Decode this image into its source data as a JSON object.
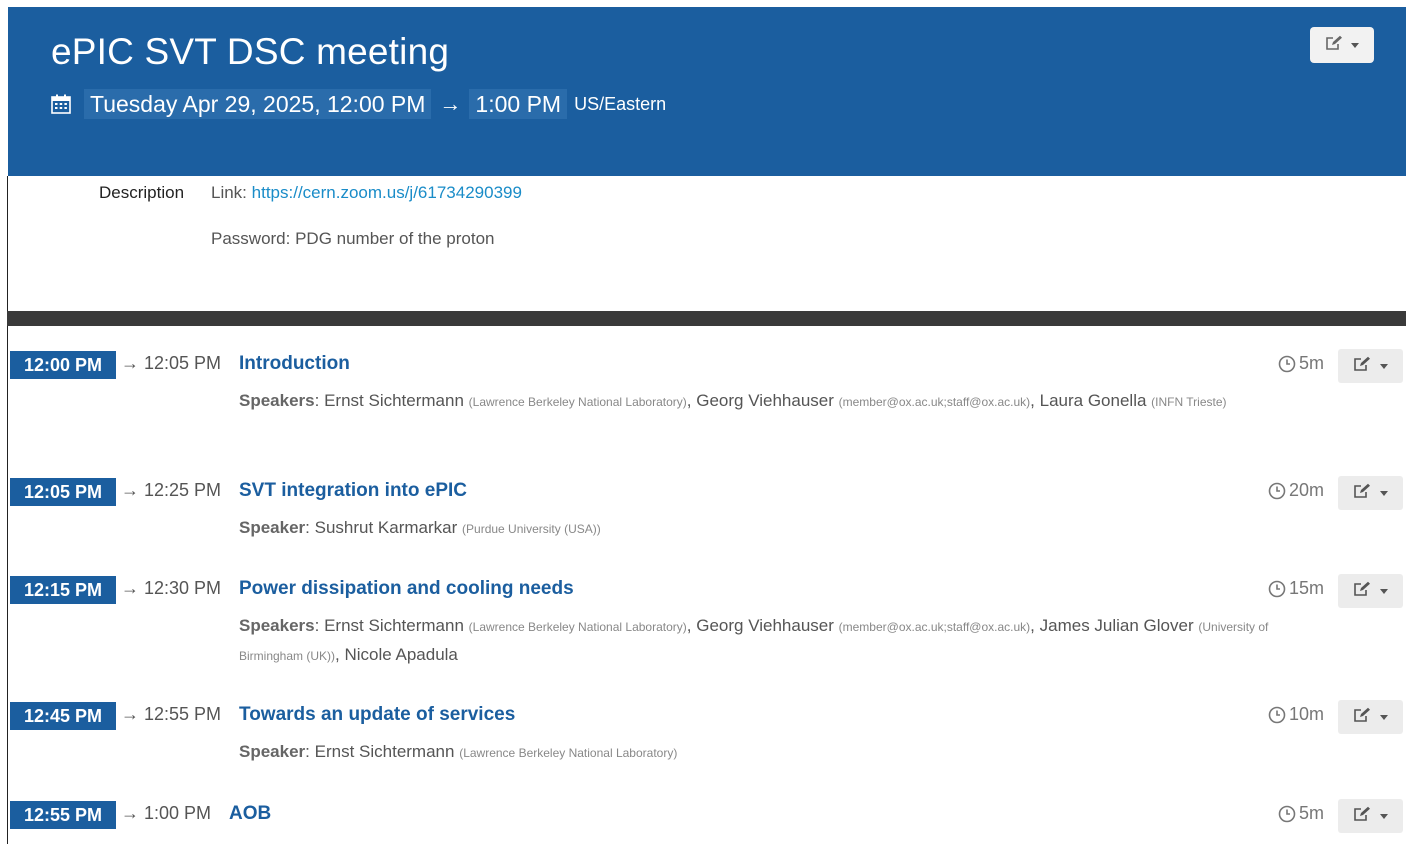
{
  "event": {
    "title": "ePIC SVT DSC meeting",
    "date_start": "Tuesday Apr 29, 2025, 12:00 PM",
    "arrow": "→",
    "time_end": "1:00 PM",
    "timezone": "US/Eastern"
  },
  "description": {
    "label": "Description",
    "link_prefix": "Link: ",
    "link_url": "https://cern.zoom.us/j/61734290399",
    "password_text": "Password: PDG number of the proton"
  },
  "colors": {
    "header_bg": "#1b5e9f",
    "accent_link": "#1a8cc8",
    "divider": "#3a3a3a"
  },
  "timetable": [
    {
      "start": "12:00 PM",
      "end": "→ 12:05 PM",
      "title": "Introduction",
      "duration": "5m",
      "speakers_label": "Speakers",
      "speakers": [
        {
          "name": "Ernst Sichtermann",
          "affiliation": "(Lawrence Berkeley National Laboratory)"
        },
        {
          "name": "Georg Viehhauser",
          "affiliation": "(member@ox.ac.uk;staff@ox.ac.uk)"
        },
        {
          "name": "Laura Gonella",
          "affiliation": "(INFN Trieste)"
        }
      ]
    },
    {
      "start": "12:05 PM",
      "end": "→ 12:25 PM",
      "title": "SVT integration into ePIC",
      "duration": "20m",
      "speakers_label": "Speaker",
      "speakers": [
        {
          "name": "Sushrut Karmarkar",
          "affiliation": "(Purdue University (USA))"
        }
      ]
    },
    {
      "start": "12:15 PM",
      "end": "→ 12:30 PM",
      "title": "Power dissipation and cooling needs",
      "duration": "15m",
      "speakers_label": "Speakers",
      "speakers": [
        {
          "name": "Ernst Sichtermann",
          "affiliation": "(Lawrence Berkeley National Laboratory)"
        },
        {
          "name": "Georg Viehhauser",
          "affiliation": "(member@ox.ac.uk;staff@ox.ac.uk)"
        },
        {
          "name": "James Julian Glover",
          "affiliation": "(University of Birmingham (UK))"
        },
        {
          "name": "Nicole Apadula",
          "affiliation": ""
        }
      ]
    },
    {
      "start": "12:45 PM",
      "end": "→ 12:55 PM",
      "title": "Towards an update of services",
      "duration": "10m",
      "speakers_label": "Speaker",
      "speakers": [
        {
          "name": "Ernst Sichtermann",
          "affiliation": "(Lawrence Berkeley National Laboratory)"
        }
      ]
    },
    {
      "start": "12:55 PM",
      "end": "→ 1:00 PM",
      "title": "AOB",
      "duration": "5m",
      "speakers_label": "",
      "speakers": []
    }
  ]
}
